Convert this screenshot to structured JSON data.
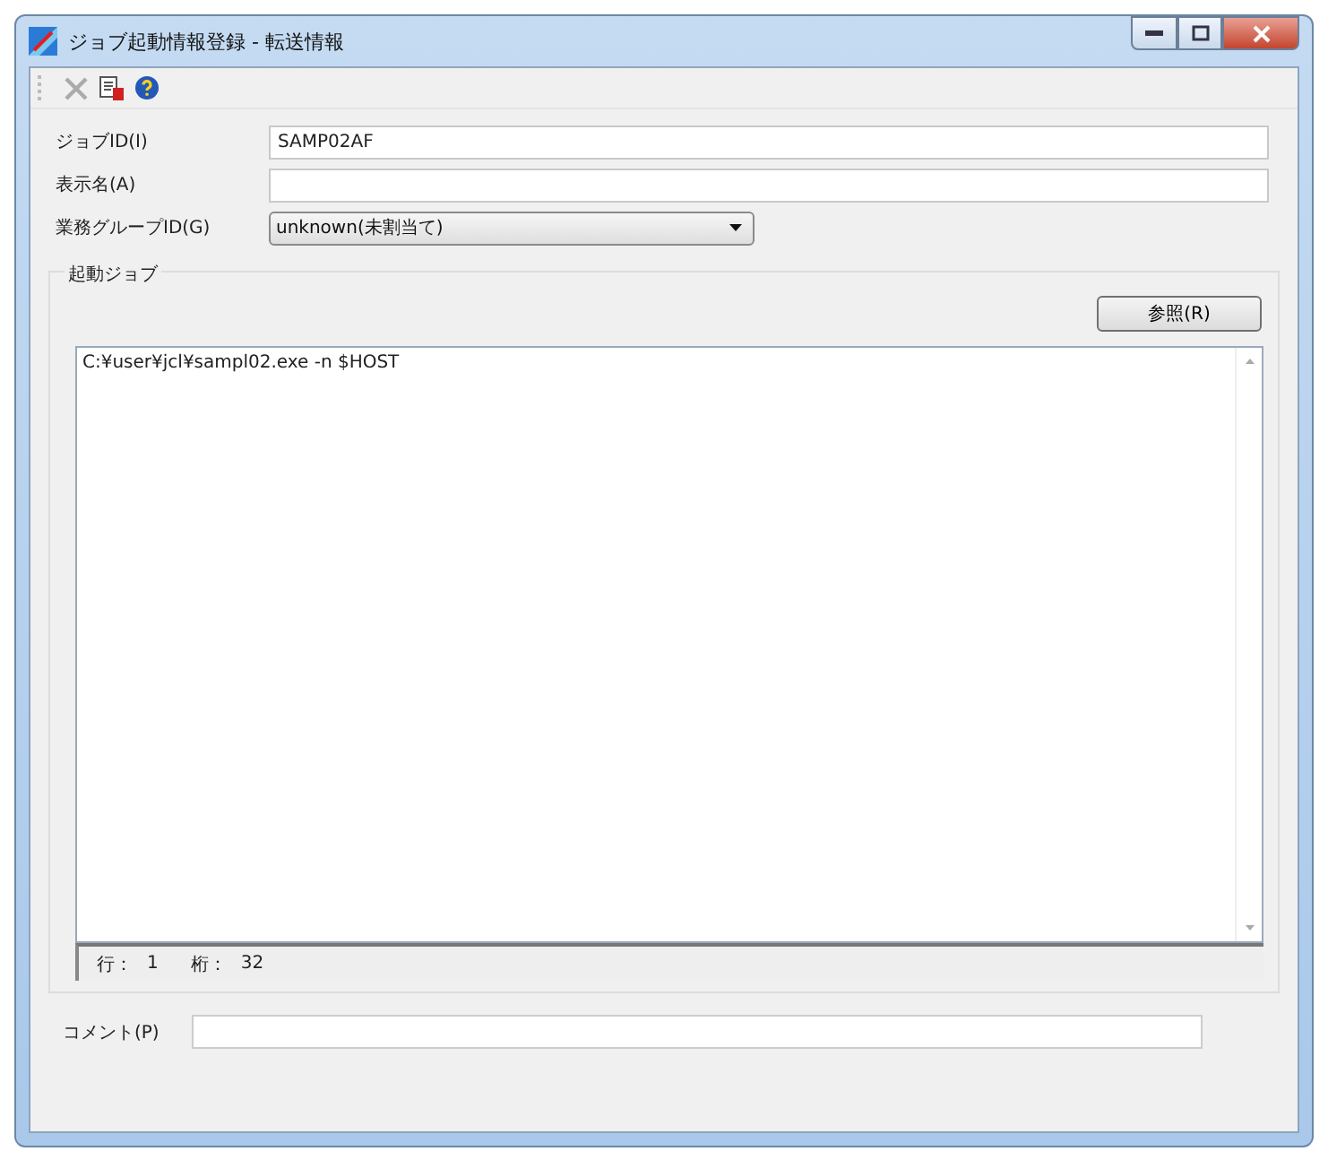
{
  "window": {
    "title": "ジョブ起動情報登録 - 転送情報"
  },
  "toolbar": [
    {
      "kind": "delete"
    },
    {
      "kind": "register"
    },
    {
      "kind": "help"
    }
  ],
  "fields": [
    {
      "label": "ジョブID(I)",
      "value": "SAMP02AF"
    },
    {
      "label": "表示名(A)"
    },
    {
      "label": "業務グループID(G)",
      "value": "unknown(未割当て)",
      "kind": "dropdown"
    }
  ],
  "start_job": {
    "title": "起動ジョブ",
    "browse_button": "参照(R)",
    "command": "C:¥user¥jcl¥sampl02.exe -n $HOST",
    "status": [
      {
        "label": "行：",
        "value": "1"
      },
      {
        "label": "桁：",
        "value": "32"
      }
    ]
  },
  "comment": {
    "label": "コメント(P)"
  }
}
